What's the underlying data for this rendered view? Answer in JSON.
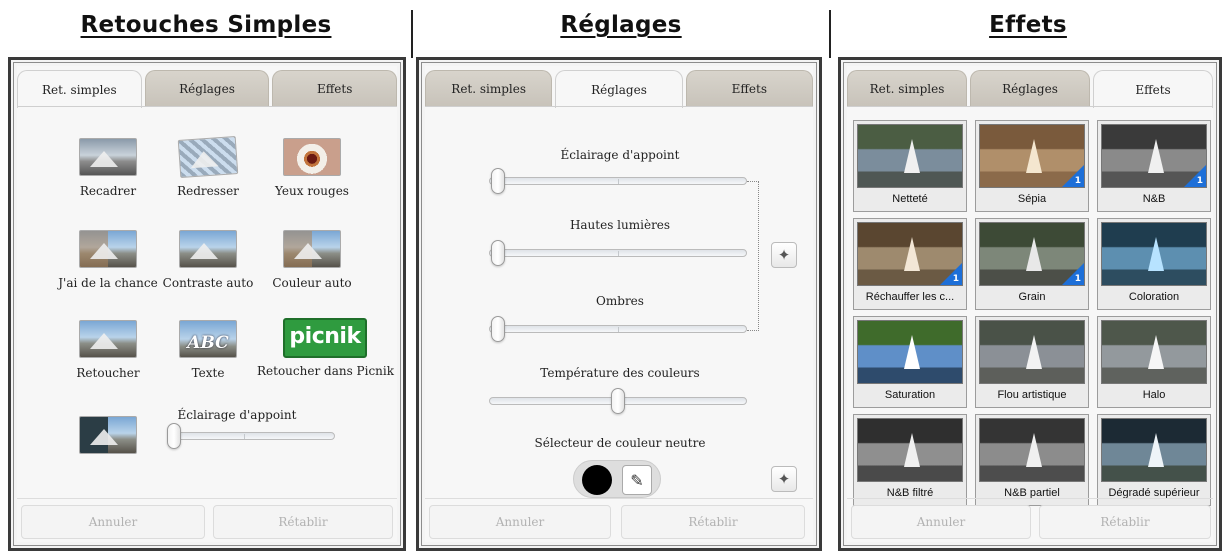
{
  "columns": [
    {
      "title": "Retouches Simples",
      "tabs": [
        "Ret. simples",
        "Réglages",
        "Effets"
      ],
      "active_tab": 0,
      "tools": [
        {
          "label": "Recadrer",
          "icon": "crop-icon"
        },
        {
          "label": "Redresser",
          "icon": "straighten-icon"
        },
        {
          "label": "Yeux rouges",
          "icon": "red-eye-icon"
        },
        {
          "label": "J'ai de la chance",
          "icon": "lucky-icon"
        },
        {
          "label": "Contraste auto",
          "icon": "auto-contrast-icon"
        },
        {
          "label": "Couleur auto",
          "icon": "auto-color-icon"
        },
        {
          "label": "Retoucher",
          "icon": "retouch-icon"
        },
        {
          "label": "Texte",
          "icon": "text-icon",
          "thumb_text": "ABC"
        },
        {
          "label": "Retoucher dans Picnik",
          "icon": "picnik-logo",
          "logo_text": "picnik"
        }
      ],
      "fill_light": {
        "label": "Éclairage d'appoint",
        "value": 0
      },
      "buttons": {
        "undo": "Annuler",
        "redo": "Rétablir"
      }
    },
    {
      "title": "Réglages",
      "tabs": [
        "Ret. simples",
        "Réglages",
        "Effets"
      ],
      "active_tab": 1,
      "sliders": [
        {
          "label": "Éclairage d'appoint",
          "value": 0
        },
        {
          "label": "Hautes lumières",
          "value": 0
        },
        {
          "label": "Ombres",
          "value": 0
        },
        {
          "label": "Température des couleurs",
          "value": 50
        }
      ],
      "neutral_picker": {
        "label": "Sélecteur de couleur neutre",
        "swatch": "#000000"
      },
      "buttons": {
        "undo": "Annuler",
        "redo": "Rétablir"
      }
    },
    {
      "title": "Effets",
      "tabs": [
        "Ret. simples",
        "Réglages",
        "Effets"
      ],
      "active_tab": 2,
      "effects": [
        {
          "label": "Netteté",
          "badge": "",
          "c1": "#4b5d43",
          "c2": "#7b8d9c",
          "c3": "#4f5754",
          "sail": "#f0f0f0"
        },
        {
          "label": "Sépia",
          "badge": "1",
          "c1": "#7a5a3c",
          "c2": "#b08f6a",
          "c3": "#8b6a4a",
          "sail": "#f4e6cf"
        },
        {
          "label": "N&B",
          "badge": "1",
          "c1": "#3a3a3a",
          "c2": "#8a8a8a",
          "c3": "#555555",
          "sail": "#f0f0f0"
        },
        {
          "label": "Réchauffer les c...",
          "badge": "1",
          "c1": "#5a4630",
          "c2": "#9e8a6e",
          "c3": "#6b5a44",
          "sail": "#f3e7d6"
        },
        {
          "label": "Grain",
          "badge": "1",
          "c1": "#3d4a36",
          "c2": "#7d8779",
          "c3": "#4c4f48",
          "sail": "#e8e8e8"
        },
        {
          "label": "Coloration",
          "badge": "",
          "c1": "#1f3d4f",
          "c2": "#5d8fb0",
          "c3": "#2d4d60",
          "sail": "#b7e3ff"
        },
        {
          "label": "Saturation",
          "badge": "",
          "c1": "#3f6b2b",
          "c2": "#5f8fc8",
          "c3": "#2e4b6c",
          "sail": "#ffffff"
        },
        {
          "label": "Flou artistique",
          "badge": "",
          "c1": "#4a5248",
          "c2": "#8b9096",
          "c3": "#5d5f5b",
          "sail": "#f2f2f2"
        },
        {
          "label": "Halo",
          "badge": "",
          "c1": "#4e574b",
          "c2": "#93999d",
          "c3": "#5f625e",
          "sail": "#f6f6f6"
        },
        {
          "label": "N&B filtré",
          "badge": "",
          "c1": "#2f2f2f",
          "c2": "#8f8f8f",
          "c3": "#4a4a4a",
          "sail": "#f0f0f0"
        },
        {
          "label": "N&B partiel",
          "badge": "",
          "c1": "#343434",
          "c2": "#8c8c8c",
          "c3": "#4d4d4d",
          "sail": "#f0f0f0"
        },
        {
          "label": "Dégradé supérieur",
          "badge": "",
          "c1": "#1c2a34",
          "c2": "#6f8797",
          "c3": "#44514a",
          "sail": "#eef4f8"
        }
      ],
      "buttons": {
        "undo": "Annuler",
        "redo": "Rétablir"
      }
    }
  ]
}
